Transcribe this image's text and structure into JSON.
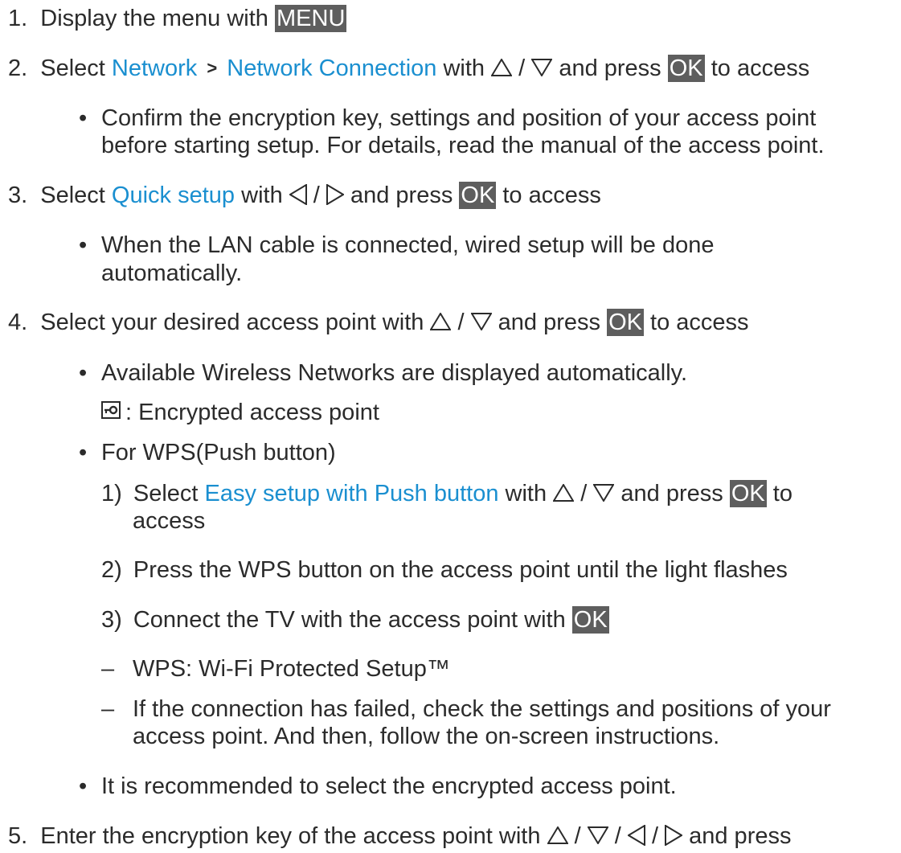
{
  "step1": {
    "num": "1.",
    "text": "Display the menu with ",
    "key": "MENU"
  },
  "step2": {
    "num": "2.",
    "pre": "Select ",
    "link1": "Network",
    "chevron": ">",
    "link2": "Network Connection",
    "mid": " with ",
    "sep": " / ",
    "post": " and press ",
    "key": "OK",
    "end": " to access"
  },
  "step2_bullet": {
    "mark": "•",
    "line1": "Confirm the encryption key, settings and position of your access point",
    "line2": "before starting setup. For details, read the manual of the access point."
  },
  "step3": {
    "num": "3.",
    "pre": "Select ",
    "link": "Quick setup",
    "mid": " with ",
    "sep": " / ",
    "post": " and press ",
    "key": "OK",
    "end": " to access"
  },
  "step3_bullet": {
    "mark": "•",
    "line1": "When the LAN cable is connected, wired setup will be done",
    "line2": "automatically."
  },
  "step4": {
    "num": "4.",
    "pre": "Select your desired access point with ",
    "sep": " / ",
    "post": " and press ",
    "key": "OK",
    "end": " to access"
  },
  "step4_bullet1": {
    "mark": "•",
    "text": "Available Wireless Networks are displayed automatically."
  },
  "encrypted_legend": ": Encrypted access point",
  "step4_bullet2": {
    "mark": "•",
    "text": "For WPS(Push button)"
  },
  "wps1": {
    "num": "1)",
    "pre": "Select ",
    "link": "Easy setup with Push button",
    "mid": " with ",
    "sep": " / ",
    "post": " and press ",
    "key": "OK",
    "end": " to",
    "line2": "access"
  },
  "wps2": {
    "num": "2)",
    "text": "Press the WPS button on the access point until the light flashes"
  },
  "wps3": {
    "num": "3)",
    "text": "Connect the TV with the access point with ",
    "key": "OK"
  },
  "dash1": {
    "mark": "–",
    "text": "WPS: Wi-Fi Protected Setup™"
  },
  "dash2": {
    "mark": "–",
    "line1": "If the connection has failed, check the settings and positions of your",
    "line2": "access point. And then, follow the on-screen instructions."
  },
  "step4_bullet3": {
    "mark": "•",
    "text": "It is recommended to select the encrypted access point."
  },
  "step5": {
    "num": "5.",
    "pre": "Enter the encryption key of the access point with ",
    "sep": " / ",
    "post": " and press"
  },
  "colors": {
    "link": "#1a8fd0",
    "key_bg": "#5e5e5e",
    "text": "#2b2b2b"
  },
  "icons": [
    "up-arrow-icon",
    "down-arrow-icon",
    "left-arrow-icon",
    "right-arrow-icon",
    "lock-icon"
  ]
}
